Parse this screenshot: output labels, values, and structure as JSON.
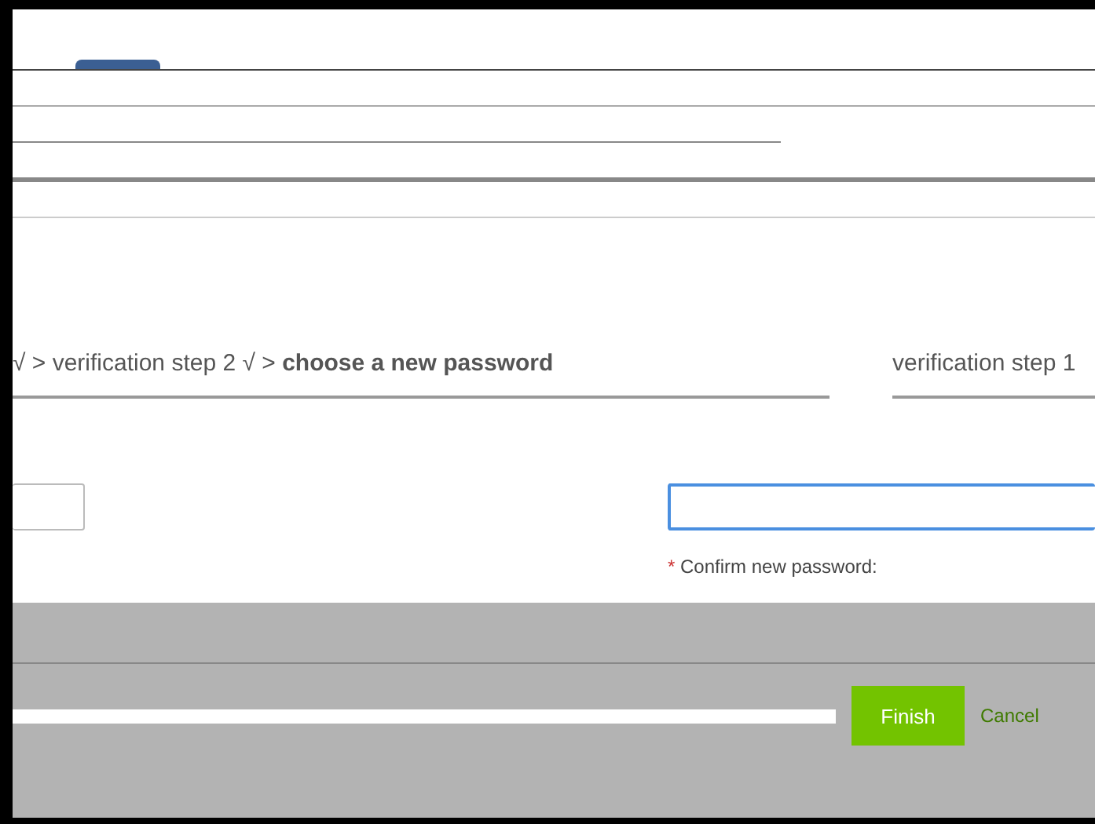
{
  "breadcrumb": {
    "trail": "√ > verification step 2 √ > **choose a new password**"
  },
  "side_breadcrumb": {
    "trail": "verification step 1"
  },
  "fields": [
    {
      "kind": "plain",
      "focused": false
    },
    {
      "kind": "password",
      "focused": true,
      "label": "Confirm new password:",
      "required_mark": "*"
    }
  ],
  "buttons": [
    {
      "label": "Finish",
      "kind": "primary"
    },
    {
      "label": "Cancel",
      "kind": "link"
    }
  ]
}
